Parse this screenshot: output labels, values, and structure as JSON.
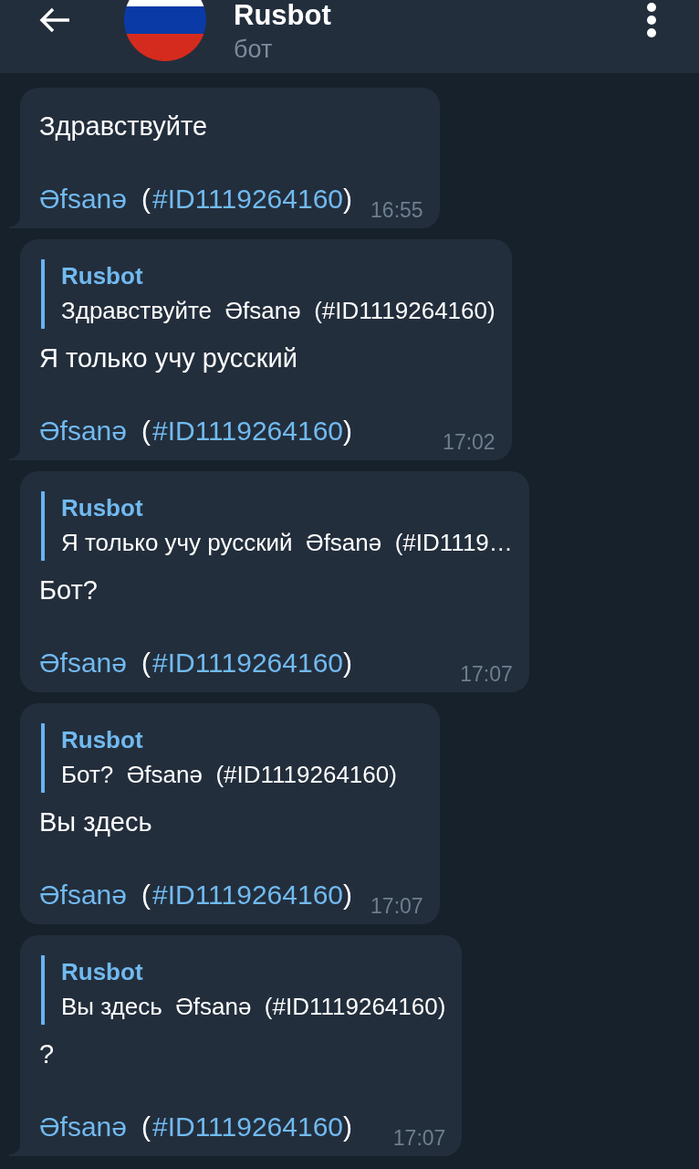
{
  "header": {
    "title": "Rusbot",
    "subtitle": "бот"
  },
  "messages": [
    {
      "tail": true,
      "text": "Здравствуйте",
      "signature": [
        {
          "text": "Əfsanə",
          "link": true
        },
        {
          "text": "(",
          "link": false
        },
        {
          "text": "#ID1119264160",
          "link": true
        },
        {
          "text": ")",
          "link": false
        }
      ],
      "time": "16:55"
    },
    {
      "tail": true,
      "quote": {
        "author": "Rusbot",
        "text": "Здравствуйте  Əfsanə  (#ID1119264160)"
      },
      "text": "Я только учу русский",
      "signature": [
        {
          "text": "Əfsanə",
          "link": true
        },
        {
          "text": "(",
          "link": false
        },
        {
          "text": "#ID1119264160",
          "link": true
        },
        {
          "text": ")",
          "link": false
        }
      ],
      "time": "17:02"
    },
    {
      "tail": false,
      "quote": {
        "author": "Rusbot",
        "text": "Я только учу русский  Əfsanə  (#ID1119…"
      },
      "text": "Бот?",
      "signature": [
        {
          "text": "Əfsanə",
          "link": true
        },
        {
          "text": "(",
          "link": false
        },
        {
          "text": "#ID1119264160",
          "link": true
        },
        {
          "text": ")",
          "link": false
        }
      ],
      "time": "17:07"
    },
    {
      "tail": false,
      "quote": {
        "author": "Rusbot",
        "text": "Бот?  Əfsanə  (#ID1119264160)"
      },
      "text": "Вы здесь",
      "signature": [
        {
          "text": "Əfsanə",
          "link": true
        },
        {
          "text": "(",
          "link": false
        },
        {
          "text": "#ID1119264160",
          "link": true
        },
        {
          "text": ")",
          "link": false
        }
      ],
      "time": "17:07"
    },
    {
      "tail": true,
      "quote": {
        "author": "Rusbot",
        "text": "Вы здесь  Əfsanə  (#ID1119264160)"
      },
      "text": "?",
      "signature": [
        {
          "text": "Əfsanə",
          "link": true
        },
        {
          "text": "(",
          "link": false
        },
        {
          "text": "#ID1119264160",
          "link": true
        },
        {
          "text": ")",
          "link": false
        }
      ],
      "time": "17:07"
    }
  ]
}
